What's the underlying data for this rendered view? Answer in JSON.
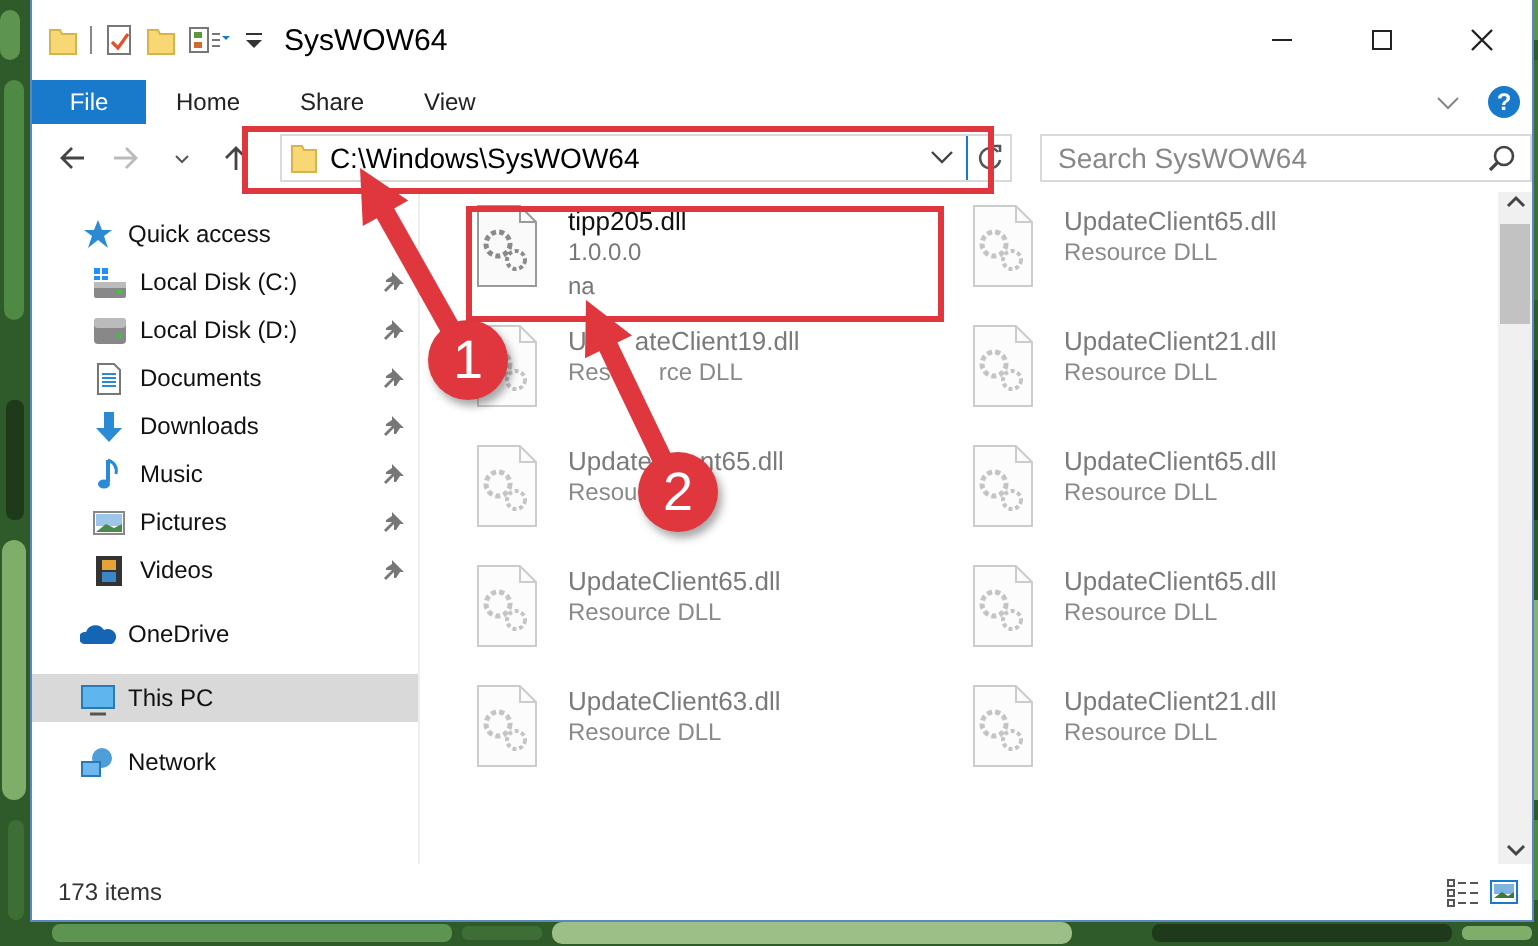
{
  "window": {
    "title": "SysWOW64"
  },
  "ribbon": {
    "tabs": [
      {
        "label": "File",
        "kind": "menu"
      },
      {
        "label": "Home",
        "kind": "tab"
      },
      {
        "label": "Share",
        "kind": "tab"
      },
      {
        "label": "View",
        "kind": "tab"
      }
    ],
    "help": "?"
  },
  "address_bar": {
    "path": "C:\\Windows\\SysWOW64"
  },
  "search": {
    "placeholder": "Search SysWOW64"
  },
  "sidebar": {
    "items": [
      {
        "label": "Quick access",
        "kind": "quick-access",
        "selected": false,
        "children": [
          {
            "label": "Local Disk (C:)",
            "kind": "system-drive",
            "pinned": true,
            "selected": false
          },
          {
            "label": "Local Disk (D:)",
            "kind": "drive",
            "pinned": true,
            "selected": false
          },
          {
            "label": "Documents",
            "kind": "documents",
            "pinned": true,
            "selected": false
          },
          {
            "label": "Downloads",
            "kind": "downloads",
            "pinned": true,
            "selected": false
          },
          {
            "label": "Music",
            "kind": "music",
            "pinned": true,
            "selected": false
          },
          {
            "label": "Pictures",
            "kind": "pictures",
            "pinned": true,
            "selected": false
          },
          {
            "label": "Videos",
            "kind": "videos",
            "pinned": true,
            "selected": false
          }
        ]
      },
      {
        "label": "OneDrive",
        "kind": "onedrive",
        "selected": false
      },
      {
        "label": "This PC",
        "kind": "pc",
        "selected": true
      },
      {
        "label": "Network",
        "kind": "network",
        "selected": false
      }
    ]
  },
  "files": [
    {
      "name_parts": [
        "tipp205.dll"
      ],
      "details": [
        [
          "1.0.0.0"
        ],
        [
          "na"
        ]
      ],
      "blurred": false
    },
    {
      "name_parts": [
        "UpdateClient65.dll"
      ],
      "details": [
        [
          "Resource DLL"
        ]
      ],
      "blurred": true
    },
    {
      "name_parts": [
        "U",
        "ateClient19.dll"
      ],
      "details": [
        [
          "Res",
          "rce DLL"
        ]
      ],
      "blurred": true
    },
    {
      "name_parts": [
        "UpdateClient21.dll"
      ],
      "details": [
        [
          "Resource DLL"
        ]
      ],
      "blurred": true
    },
    {
      "name_parts": [
        "Update",
        "nt65.dll"
      ],
      "details": [
        [
          "Resou"
        ]
      ],
      "blurred": true
    },
    {
      "name_parts": [
        "UpdateClient65.dll"
      ],
      "details": [
        [
          "Resource DLL"
        ]
      ],
      "blurred": true
    },
    {
      "name_parts": [
        "UpdateClient65.dll"
      ],
      "details": [
        [
          "Resource DLL"
        ]
      ],
      "blurred": true
    },
    {
      "name_parts": [
        "UpdateClient65.dll"
      ],
      "details": [
        [
          "Resource DLL"
        ]
      ],
      "blurred": true
    },
    {
      "name_parts": [
        "UpdateClient63.dll"
      ],
      "details": [
        [
          "Resource DLL"
        ]
      ],
      "blurred": true
    },
    {
      "name_parts": [
        "UpdateClient21.dll"
      ],
      "details": [
        [
          "Resource DLL"
        ]
      ],
      "blurred": true
    }
  ],
  "status_bar": {
    "item_count": "173 items"
  },
  "annotations": [
    {
      "label": "1"
    },
    {
      "label": "2"
    }
  ]
}
